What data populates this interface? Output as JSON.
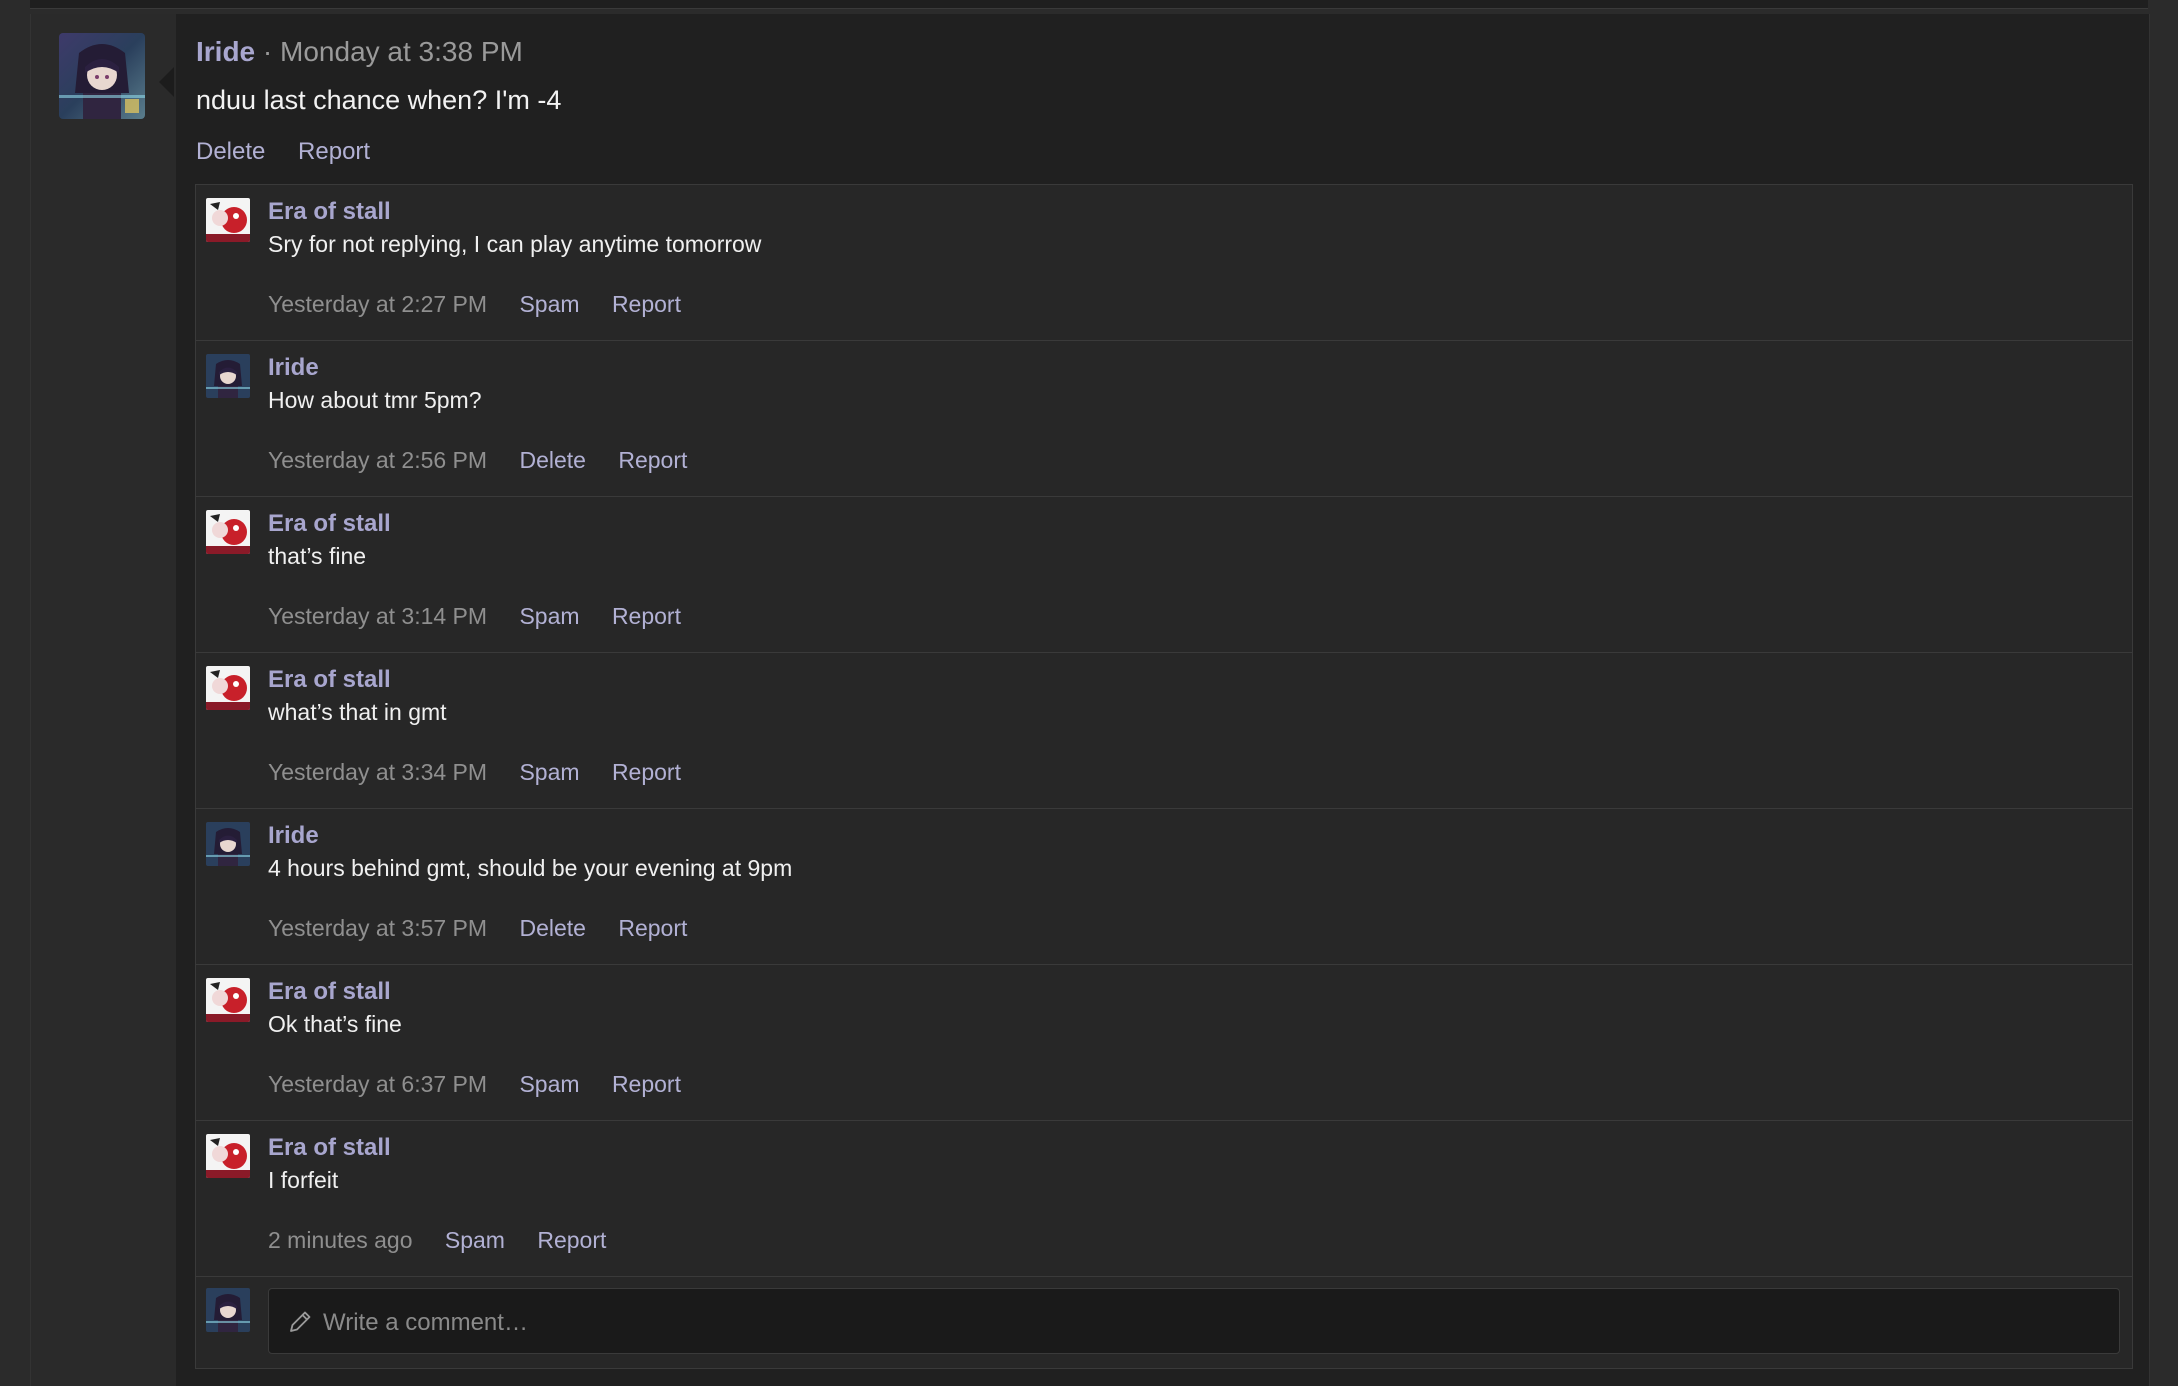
{
  "message": {
    "author": "Iride",
    "separator": "·",
    "time": "Monday at 3:38 PM",
    "body": "nduu last chance when? I'm -4",
    "actions": [
      "Delete",
      "Report"
    ],
    "avatar_icon": "iride-avatar"
  },
  "comments": [
    {
      "author": "Era of stall",
      "text": "Sry for not replying, I can play anytime tomorrow",
      "time": "Yesterday at 2:27 PM",
      "actions": [
        "Spam",
        "Report"
      ],
      "avatar_icon": "era-of-stall-avatar"
    },
    {
      "author": "Iride",
      "text": "How about tmr 5pm?",
      "time": "Yesterday at 2:56 PM",
      "actions": [
        "Delete",
        "Report"
      ],
      "avatar_icon": "iride-avatar"
    },
    {
      "author": "Era of stall",
      "text": "that’s fine",
      "time": "Yesterday at 3:14 PM",
      "actions": [
        "Spam",
        "Report"
      ],
      "avatar_icon": "era-of-stall-avatar"
    },
    {
      "author": "Era of stall",
      "text": "what’s that in gmt",
      "time": "Yesterday at 3:34 PM",
      "actions": [
        "Spam",
        "Report"
      ],
      "avatar_icon": "era-of-stall-avatar"
    },
    {
      "author": "Iride",
      "text": "4 hours behind gmt, should be your evening at 9pm",
      "time": "Yesterday at 3:57 PM",
      "actions": [
        "Delete",
        "Report"
      ],
      "avatar_icon": "iride-avatar"
    },
    {
      "author": "Era of stall",
      "text": "Ok that’s fine",
      "time": "Yesterday at 6:37 PM",
      "actions": [
        "Spam",
        "Report"
      ],
      "avatar_icon": "era-of-stall-avatar"
    },
    {
      "author": "Era of stall",
      "text": "I forfeit",
      "time": "2 minutes ago",
      "actions": [
        "Spam",
        "Report"
      ],
      "avatar_icon": "era-of-stall-avatar"
    }
  ],
  "composer": {
    "placeholder": "Write a comment…",
    "icon": "pencil-icon",
    "avatar_icon": "iride-avatar"
  },
  "colors": {
    "author": "#a8a6ce",
    "link": "#b2b1d4",
    "muted": "#8f8f8f",
    "panel": "#202020"
  }
}
